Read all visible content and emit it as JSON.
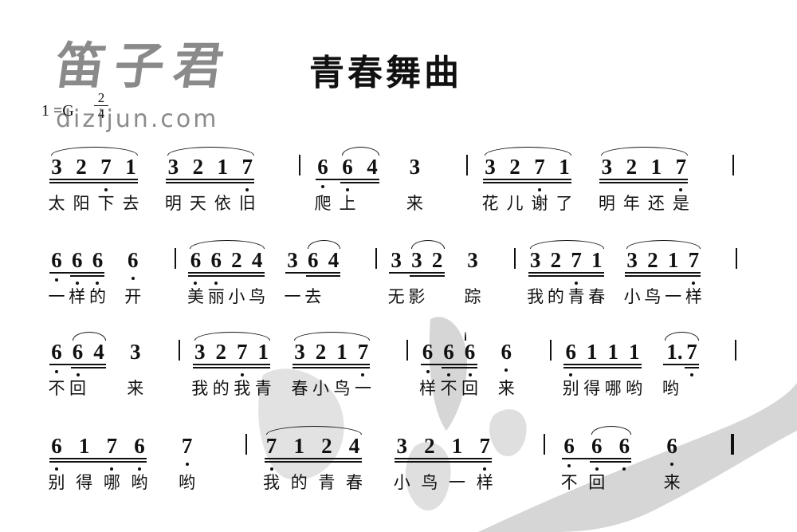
{
  "title": "青春舞曲",
  "watermark": {
    "brand_cn": "笛子君",
    "url": "dizijun.com"
  },
  "key_signature": "1 =G",
  "time_signature": {
    "numerator": "2",
    "denominator": "4"
  },
  "colors": {
    "ink": "#111111",
    "watermark": "#8a8a8a",
    "background_wash": "#c8c8c8"
  },
  "rows": [
    {
      "items": [
        {
          "type": "group",
          "slur": true,
          "lines": 2,
          "notes": [
            {
              "n": "3"
            },
            {
              "n": "2"
            },
            {
              "n": "7",
              "low": true
            },
            {
              "n": "1"
            }
          ],
          "lyrics": [
            "太",
            "阳",
            "下",
            "去"
          ]
        },
        {
          "type": "group",
          "slur": true,
          "lines": 2,
          "notes": [
            {
              "n": "3"
            },
            {
              "n": "2"
            },
            {
              "n": "1"
            },
            {
              "n": "7",
              "low": true
            }
          ],
          "lyrics": [
            "明",
            "天",
            "依",
            "旧"
          ]
        },
        {
          "type": "bar"
        },
        {
          "type": "group",
          "lines": 1,
          "inner_double": [
            1,
            2
          ],
          "slur_range": [
            1,
            2
          ],
          "notes": [
            {
              "n": "6",
              "low": true
            },
            {
              "n": "6",
              "low": true
            },
            {
              "n": "4"
            }
          ],
          "lyrics": [
            "爬",
            "上",
            ""
          ]
        },
        {
          "type": "group",
          "lines": 0,
          "notes": [
            {
              "n": "3"
            }
          ],
          "lyrics": [
            "来"
          ]
        },
        {
          "type": "bar"
        },
        {
          "type": "group",
          "slur": true,
          "lines": 2,
          "notes": [
            {
              "n": "3"
            },
            {
              "n": "2"
            },
            {
              "n": "7",
              "low": true
            },
            {
              "n": "1"
            }
          ],
          "lyrics": [
            "花",
            "儿",
            "谢",
            "了"
          ]
        },
        {
          "type": "group",
          "slur": true,
          "lines": 2,
          "notes": [
            {
              "n": "3"
            },
            {
              "n": "2"
            },
            {
              "n": "1"
            },
            {
              "n": "7",
              "low": true
            }
          ],
          "lyrics": [
            "明",
            "年",
            "还",
            "是"
          ]
        },
        {
          "type": "bar"
        }
      ]
    },
    {
      "items": [
        {
          "type": "group",
          "lines": 1,
          "inner_double": [
            1,
            2
          ],
          "notes": [
            {
              "n": "6",
              "low": true
            },
            {
              "n": "6",
              "low": true
            },
            {
              "n": "6",
              "low": true
            }
          ],
          "lyrics": [
            "一",
            "样",
            "的"
          ]
        },
        {
          "type": "group",
          "lines": 0,
          "notes": [
            {
              "n": "6",
              "low": true
            }
          ],
          "lyrics": [
            "开"
          ]
        },
        {
          "type": "bar"
        },
        {
          "type": "group",
          "slur": true,
          "lines": 2,
          "notes": [
            {
              "n": "6",
              "low": true
            },
            {
              "n": "6",
              "low": true
            },
            {
              "n": "2"
            },
            {
              "n": "4"
            }
          ],
          "lyrics": [
            "美",
            "丽",
            "小",
            "鸟"
          ]
        },
        {
          "type": "group",
          "lines": 1,
          "inner_double": [
            1,
            2
          ],
          "slur_range": [
            1,
            2
          ],
          "notes": [
            {
              "n": "3"
            },
            {
              "n": "6"
            },
            {
              "n": "4"
            }
          ],
          "lyrics": [
            "一",
            "去",
            ""
          ]
        },
        {
          "type": "bar"
        },
        {
          "type": "group",
          "lines": 1,
          "inner_double": [
            1,
            2
          ],
          "slur_range": [
            1,
            2
          ],
          "notes": [
            {
              "n": "3"
            },
            {
              "n": "3"
            },
            {
              "n": "2"
            }
          ],
          "lyrics": [
            "无",
            "影",
            ""
          ]
        },
        {
          "type": "group",
          "lines": 0,
          "notes": [
            {
              "n": "3"
            }
          ],
          "lyrics": [
            "踪"
          ]
        },
        {
          "type": "bar"
        },
        {
          "type": "group",
          "slur": true,
          "lines": 2,
          "notes": [
            {
              "n": "3"
            },
            {
              "n": "2"
            },
            {
              "n": "7",
              "low": true
            },
            {
              "n": "1"
            }
          ],
          "lyrics": [
            "我",
            "的",
            "青",
            "春"
          ]
        },
        {
          "type": "group",
          "slur": true,
          "lines": 2,
          "notes": [
            {
              "n": "3"
            },
            {
              "n": "2"
            },
            {
              "n": "1"
            },
            {
              "n": "7",
              "low": true
            }
          ],
          "lyrics": [
            "小",
            "鸟",
            "一",
            "样"
          ]
        },
        {
          "type": "bar"
        }
      ]
    },
    {
      "items": [
        {
          "type": "group",
          "lines": 1,
          "inner_double": [
            1,
            2
          ],
          "slur_range": [
            1,
            2
          ],
          "notes": [
            {
              "n": "6",
              "low": true
            },
            {
              "n": "6",
              "low": true
            },
            {
              "n": "4"
            }
          ],
          "lyrics": [
            "不",
            "回",
            ""
          ]
        },
        {
          "type": "group",
          "lines": 0,
          "notes": [
            {
              "n": "3"
            }
          ],
          "lyrics": [
            "来"
          ]
        },
        {
          "type": "bar"
        },
        {
          "type": "group",
          "slur": true,
          "lines": 2,
          "notes": [
            {
              "n": "3"
            },
            {
              "n": "2"
            },
            {
              "n": "7",
              "low": true
            },
            {
              "n": "1"
            }
          ],
          "lyrics": [
            "我",
            "的",
            "我",
            "青"
          ]
        },
        {
          "type": "group",
          "slur": true,
          "lines": 2,
          "notes": [
            {
              "n": "3"
            },
            {
              "n": "2"
            },
            {
              "n": "1"
            },
            {
              "n": "7",
              "low": true
            }
          ],
          "lyrics": [
            "春",
            "小",
            "鸟",
            "一"
          ]
        },
        {
          "type": "bar"
        },
        {
          "type": "group",
          "lines": 1,
          "inner_double": [
            1,
            2
          ],
          "slur_range": [
            2,
            3
          ],
          "notes": [
            {
              "n": "6",
              "low": true
            },
            {
              "n": "6",
              "low": true
            },
            {
              "n": "6",
              "low": true
            }
          ],
          "lyrics": [
            "样",
            "不",
            "回"
          ]
        },
        {
          "type": "group",
          "lines": 0,
          "notes": [
            {
              "n": "6",
              "low": true
            }
          ],
          "lyrics": [
            "来"
          ]
        },
        {
          "type": "bar"
        },
        {
          "type": "group",
          "lines": 2,
          "notes": [
            {
              "n": "6",
              "low": true
            },
            {
              "n": "1"
            },
            {
              "n": "1"
            },
            {
              "n": "1"
            }
          ],
          "lyrics": [
            "别",
            "得",
            "哪",
            "哟"
          ]
        },
        {
          "type": "group",
          "lines": 1,
          "inner_double": [
            1,
            1
          ],
          "slur_range": [
            0,
            1
          ],
          "notes": [
            {
              "n": "1."
            },
            {
              "n": "7",
              "low": true
            }
          ],
          "lyrics": [
            "哟",
            ""
          ]
        },
        {
          "type": "bar"
        }
      ]
    },
    {
      "items": [
        {
          "type": "group",
          "lines": 2,
          "notes": [
            {
              "n": "6",
              "low": true
            },
            {
              "n": "1"
            },
            {
              "n": "7",
              "low": true
            },
            {
              "n": "6",
              "low": true
            }
          ],
          "lyrics": [
            "别",
            "得",
            "哪",
            "哟"
          ]
        },
        {
          "type": "group",
          "lines": 0,
          "notes": [
            {
              "n": "7",
              "low": true
            }
          ],
          "lyrics": [
            "哟"
          ]
        },
        {
          "type": "bar"
        },
        {
          "type": "group",
          "slur": true,
          "lines": 2,
          "notes": [
            {
              "n": "7",
              "low": true
            },
            {
              "n": "1"
            },
            {
              "n": "2"
            },
            {
              "n": "4"
            }
          ],
          "lyrics": [
            "我",
            "的",
            "青",
            "春"
          ]
        },
        {
          "type": "group",
          "lines": 2,
          "notes": [
            {
              "n": "3"
            },
            {
              "n": "2"
            },
            {
              "n": "1"
            },
            {
              "n": "7",
              "low": true
            }
          ],
          "lyrics": [
            "小",
            "鸟",
            "一",
            "样"
          ]
        },
        {
          "type": "bar"
        },
        {
          "type": "group",
          "lines": 1,
          "inner_double": [
            1,
            2
          ],
          "slur_range": [
            1,
            2
          ],
          "notes": [
            {
              "n": "6",
              "low": true
            },
            {
              "n": "6",
              "low": true
            },
            {
              "n": "6",
              "low": true
            }
          ],
          "lyrics": [
            "不",
            "回",
            ""
          ]
        },
        {
          "type": "group",
          "lines": 0,
          "notes": [
            {
              "n": "6",
              "low": true
            }
          ],
          "lyrics": [
            "来"
          ]
        },
        {
          "type": "bar",
          "final": true
        }
      ]
    }
  ]
}
